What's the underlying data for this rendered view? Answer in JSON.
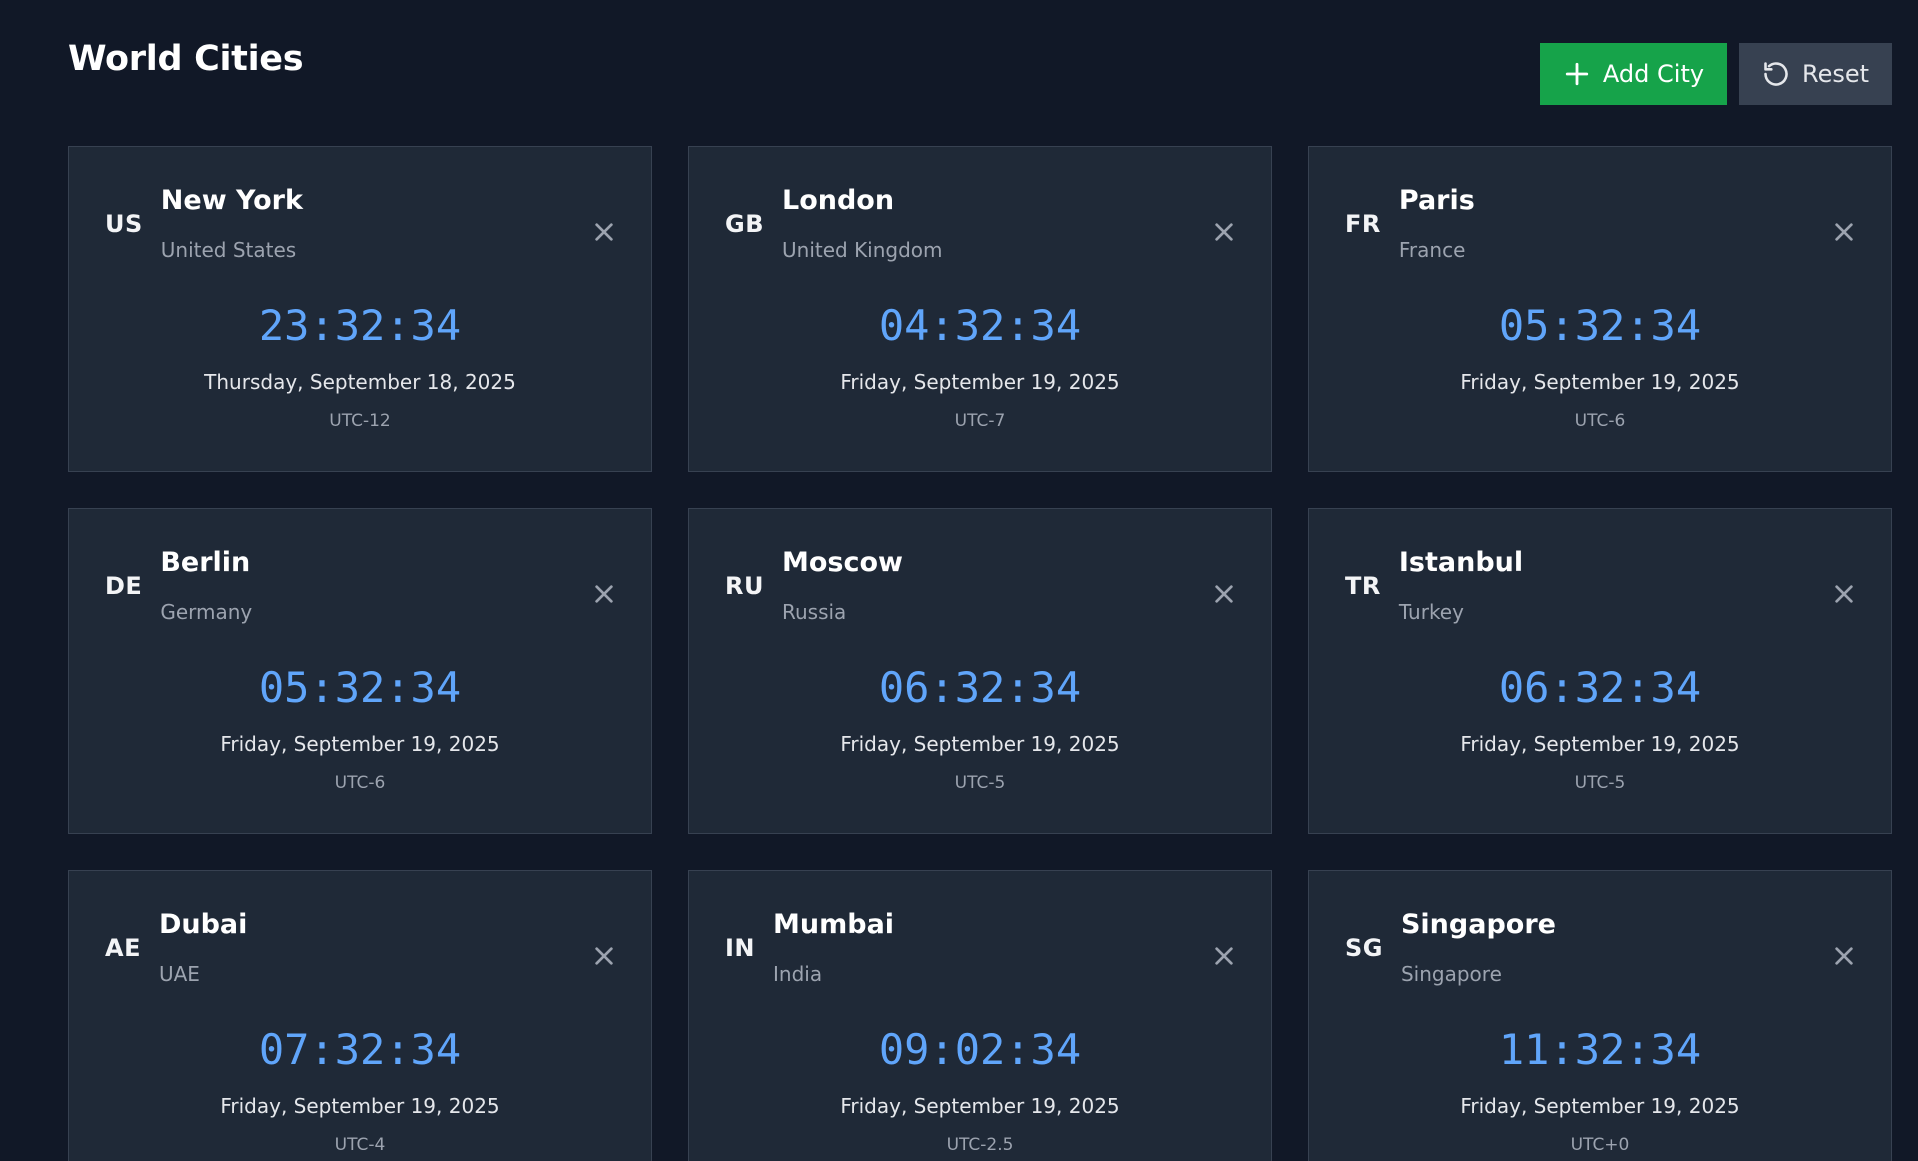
{
  "header": {
    "title": "World Cities",
    "add_label": "Add City",
    "reset_label": "Reset"
  },
  "colors": {
    "background": "#111827",
    "card": "#1f2937",
    "time": "#60a5fa",
    "add_button": "#16a34a",
    "reset_button": "#374151"
  },
  "icons": {
    "add": "plus-icon",
    "reset": "rotate-ccw-icon",
    "remove": "close-icon"
  },
  "cities": [
    {
      "code": "US",
      "city": "New York",
      "country": "United States",
      "time": "23:32:34",
      "date": "Thursday, September 18, 2025",
      "offset": "UTC-12"
    },
    {
      "code": "GB",
      "city": "London",
      "country": "United Kingdom",
      "time": "04:32:34",
      "date": "Friday, September 19, 2025",
      "offset": "UTC-7"
    },
    {
      "code": "FR",
      "city": "Paris",
      "country": "France",
      "time": "05:32:34",
      "date": "Friday, September 19, 2025",
      "offset": "UTC-6"
    },
    {
      "code": "DE",
      "city": "Berlin",
      "country": "Germany",
      "time": "05:32:34",
      "date": "Friday, September 19, 2025",
      "offset": "UTC-6"
    },
    {
      "code": "RU",
      "city": "Moscow",
      "country": "Russia",
      "time": "06:32:34",
      "date": "Friday, September 19, 2025",
      "offset": "UTC-5"
    },
    {
      "code": "TR",
      "city": "Istanbul",
      "country": "Turkey",
      "time": "06:32:34",
      "date": "Friday, September 19, 2025",
      "offset": "UTC-5"
    },
    {
      "code": "AE",
      "city": "Dubai",
      "country": "UAE",
      "time": "07:32:34",
      "date": "Friday, September 19, 2025",
      "offset": "UTC-4"
    },
    {
      "code": "IN",
      "city": "Mumbai",
      "country": "India",
      "time": "09:02:34",
      "date": "Friday, September 19, 2025",
      "offset": "UTC-2.5"
    },
    {
      "code": "SG",
      "city": "Singapore",
      "country": "Singapore",
      "time": "11:32:34",
      "date": "Friday, September 19, 2025",
      "offset": "UTC+0"
    }
  ]
}
